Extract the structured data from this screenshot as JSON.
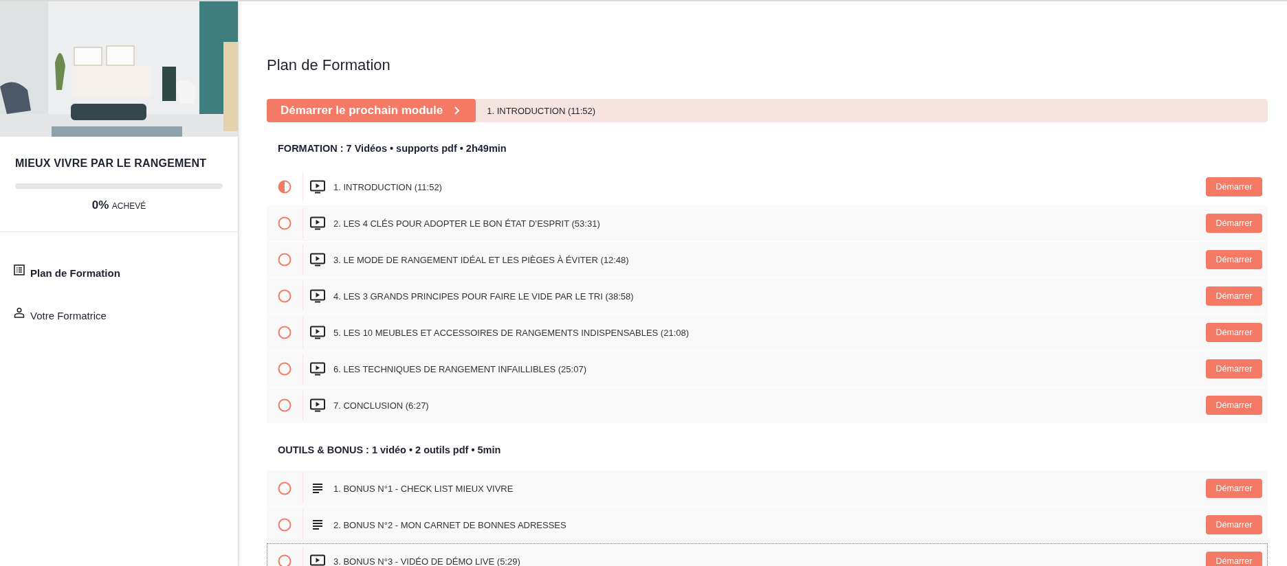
{
  "sidebar": {
    "course_title": "MIEUX VIVRE PAR LE RANGEMENT",
    "progress": {
      "level": 0,
      "percent": "0%",
      "label": "ACHEVÉ"
    },
    "items": [
      {
        "label": "Plan de Formation",
        "selected": true
      },
      {
        "label": "Votre Formatrice",
        "selected": false
      }
    ]
  },
  "main": {
    "title": "Plan de Formation",
    "next": {
      "button": "Démarrer le prochain module",
      "lesson": "1. INTRODUCTION (11:52)"
    },
    "sections": [
      {
        "heading": "FORMATION : 7 Vidéos • supports pdf • 2h49min",
        "lessons": [
          {
            "kind": "video",
            "title": "1. INTRODUCTION (11:52)",
            "started": true,
            "focused": false,
            "button": "Démarrer"
          },
          {
            "kind": "video",
            "title": "2. LES 4 CLÉS POUR ADOPTER LE BON ÉTAT D’ESPRIT (53:31)",
            "started": false,
            "focused": false,
            "button": "Démarrer"
          },
          {
            "kind": "video",
            "title": "3. LE MODE DE RANGEMENT IDÉAL ET LES PIÈGES À ÉVITER (12:48)",
            "started": false,
            "focused": false,
            "button": "Démarrer"
          },
          {
            "kind": "video",
            "title": "4. LES 3 GRANDS PRINCIPES POUR FAIRE LE VIDE PAR LE TRI (38:58)",
            "started": false,
            "focused": false,
            "button": "Démarrer"
          },
          {
            "kind": "video",
            "title": "5. LES 10 MEUBLES ET ACCESSOIRES DE RANGEMENTS INDISPENSABLES (21:08)",
            "started": false,
            "focused": false,
            "button": "Démarrer"
          },
          {
            "kind": "video",
            "title": "6. LES TECHNIQUES DE RANGEMENT INFAILLIBLES (25:07)",
            "started": false,
            "focused": false,
            "button": "Démarrer"
          },
          {
            "kind": "video",
            "title": "7. CONCLUSION (6:27)",
            "started": false,
            "focused": false,
            "button": "Démarrer"
          }
        ]
      },
      {
        "heading": "OUTILS & BONUS : 1 vidéo • 2 outils pdf • 5min",
        "lessons": [
          {
            "kind": "text",
            "title": "1. BONUS N°1 - CHECK LIST MIEUX VIVRE",
            "started": false,
            "focused": false,
            "button": "Démarrer"
          },
          {
            "kind": "text",
            "title": "2. BONUS N°2 - MON CARNET DE BONNES ADRESSES",
            "started": false,
            "focused": false,
            "button": "Démarrer"
          },
          {
            "kind": "video",
            "title": "3. BONUS N°3 - VIDÉO DE DÉMO LIVE (5:29)",
            "started": false,
            "focused": true,
            "button": "Démarrer"
          }
        ]
      }
    ]
  }
}
